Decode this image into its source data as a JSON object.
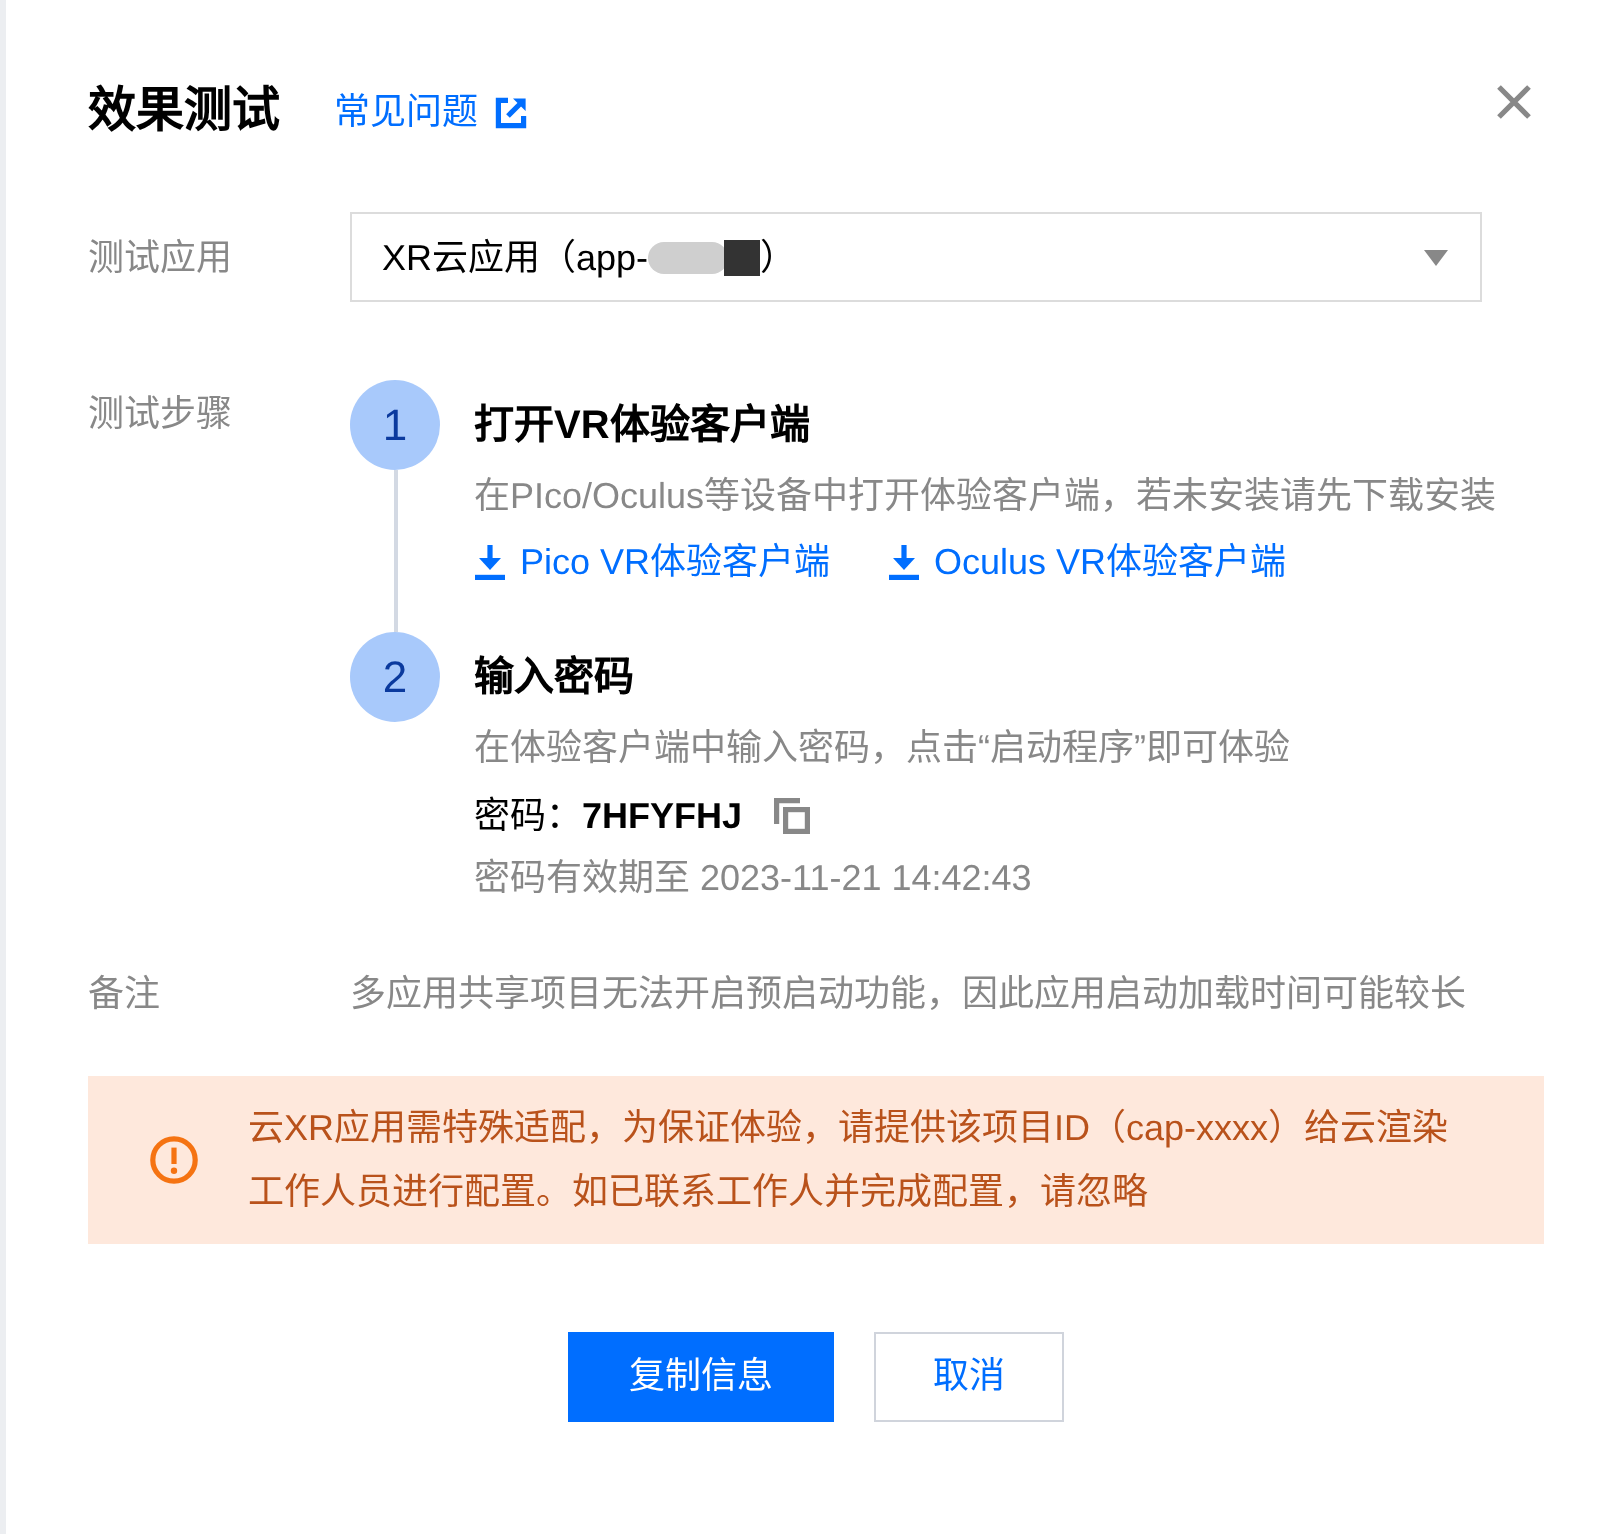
{
  "dialog": {
    "title": "效果测试",
    "help_link": "常见问题"
  },
  "fields": [
    {
      "label": "测试应用",
      "kind": "select",
      "value": "XR云应用（app-",
      "redacted": true,
      "value_end": "）"
    }
  ],
  "steps_section": {
    "label": "测试步骤",
    "steps": [
      {
        "kind": "download",
        "number": "1",
        "title": "打开VR体验客户端",
        "description": "在PIco/Oculus等设备中打开体验客户端，若未安装请先下载安装",
        "links": [
          {
            "label": "Pico VR体验客户端"
          },
          {
            "label": "Oculus VR体验客户端"
          }
        ]
      },
      {
        "kind": "password",
        "number": "2",
        "title": "输入密码",
        "description": "在体验客户端中输入密码，点击“启动程序”即可体验",
        "password_label": "密码：",
        "password": "7HFYFHJ",
        "expiry": "密码有效期至 2023-11-21 14:42:43"
      }
    ]
  },
  "note": {
    "label": "备注",
    "text": "多应用共享项目无法开启预启动功能，因此应用启动加载时间可能较长"
  },
  "alert": {
    "kind": "warning",
    "text": "云XR应用需特殊适配，为保证体验，请提供该项目ID（cap-xxxx）给云渲染工作人员进行配置。如已联系工作人并完成配置，请忽略"
  },
  "buttons": [
    {
      "label": "复制信息",
      "kind": "primary"
    },
    {
      "label": "取消",
      "kind": "secondary"
    }
  ]
}
